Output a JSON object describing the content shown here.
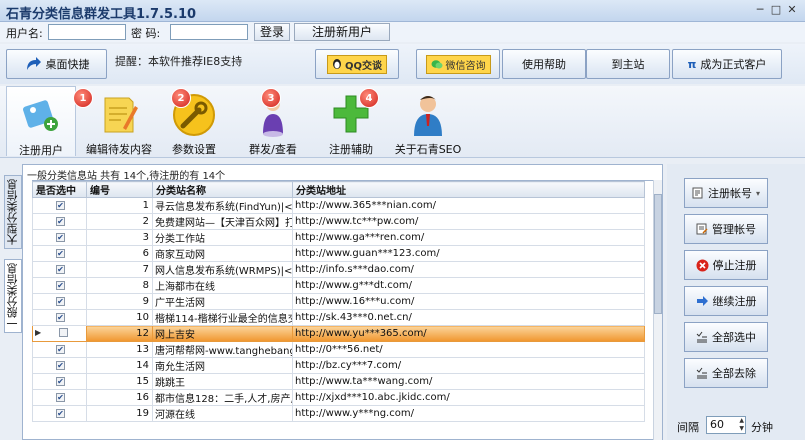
{
  "window": {
    "title": "石青分类信息群发工具1.7.5.10"
  },
  "login": {
    "username_label": "用户名:",
    "password_label": "密  码:",
    "login_button": "登录",
    "register_button": "注册新用户",
    "username_value": "",
    "password_value": ""
  },
  "quickbar": {
    "desktop_shortcut": "桌面快捷",
    "tip": "提醒：本软件推荐IE8支持",
    "qq": "QQ交谈",
    "wechat": "微信咨询",
    "help": "使用帮助",
    "home": "到主站",
    "pi": "π",
    "become_customer": "成为正式客户"
  },
  "toolbar": {
    "items": [
      {
        "label": "注册用户"
      },
      {
        "label": "编辑待发内容",
        "badge": "1"
      },
      {
        "label": "参数设置",
        "badge": "2"
      },
      {
        "label": "群发/查看",
        "badge": "3"
      },
      {
        "label": "注册辅助",
        "badge": "4"
      },
      {
        "label": "关于石青SEO"
      }
    ]
  },
  "side_tabs": [
    "大型分类信息站",
    "一般分类信息站"
  ],
  "panel": {
    "caption": "一般分类信息站 共有 14个,待注册的有 14个",
    "columns": [
      "是否选中",
      "编号",
      "分类站名称",
      "分类站地址"
    ],
    "rows": [
      {
        "checked": true,
        "id": "1",
        "name": "寻云信息发布系统(FindYun)|<<最",
        "url": "http://www.365***nian.com/"
      },
      {
        "checked": true,
        "id": "2",
        "name": "免费建网站—【天津百众网】打造",
        "url": "http://www.tc***pw.com/"
      },
      {
        "checked": true,
        "id": "3",
        "name": "分类工作站",
        "url": "http://www.ga***ren.com/"
      },
      {
        "checked": true,
        "id": "6",
        "name": "商家互动网",
        "url": "http://www.guan***123.com/"
      },
      {
        "checked": true,
        "id": "7",
        "name": "网人信息发布系统(WRMPS)|<<最专",
        "url": "http://info.s***dao.com/"
      },
      {
        "checked": true,
        "id": "8",
        "name": "上海都市在线",
        "url": "http://www.g***dt.com/"
      },
      {
        "checked": true,
        "id": "9",
        "name": "广平生活网",
        "url": "http://www.16***u.com/"
      },
      {
        "checked": true,
        "id": "10",
        "name": "楷梯114-楷梯行业最全的信息交流",
        "url": "http://sk.43***0.net.cn/"
      },
      {
        "checked": false,
        "id": "12",
        "name": "网上吉安",
        "url": "http://www.yu***365.com/",
        "highlighted": true
      },
      {
        "checked": true,
        "id": "13",
        "name": "唐河帮帮网-www.tanghebangbang",
        "url": "http://0***56.net/"
      },
      {
        "checked": true,
        "id": "14",
        "name": "南允生活网",
        "url": "http://bz.cy***7.com/"
      },
      {
        "checked": true,
        "id": "15",
        "name": "跳跳王",
        "url": "http://www.ta***wang.com/"
      },
      {
        "checked": true,
        "id": "16",
        "name": "都市信息128：二手,人才,房产,免费",
        "url": "http://xjxd***10.abc.jkidc.com/"
      },
      {
        "checked": true,
        "id": "19",
        "name": "河源在线",
        "url": "http://www.y***ng.com/"
      }
    ]
  },
  "actions": {
    "register_account": "注册帐号",
    "manage_account": "管理帐号",
    "stop_register": "停止注册",
    "continue_register": "继续注册",
    "select_all": "全部选中",
    "deselect_all": "全部去除",
    "interval_label": "间隔",
    "interval_value": "60",
    "minutes_label": "分钟"
  },
  "colors": {
    "highlight": "#f0962e",
    "accent": "#1b3a6b"
  }
}
